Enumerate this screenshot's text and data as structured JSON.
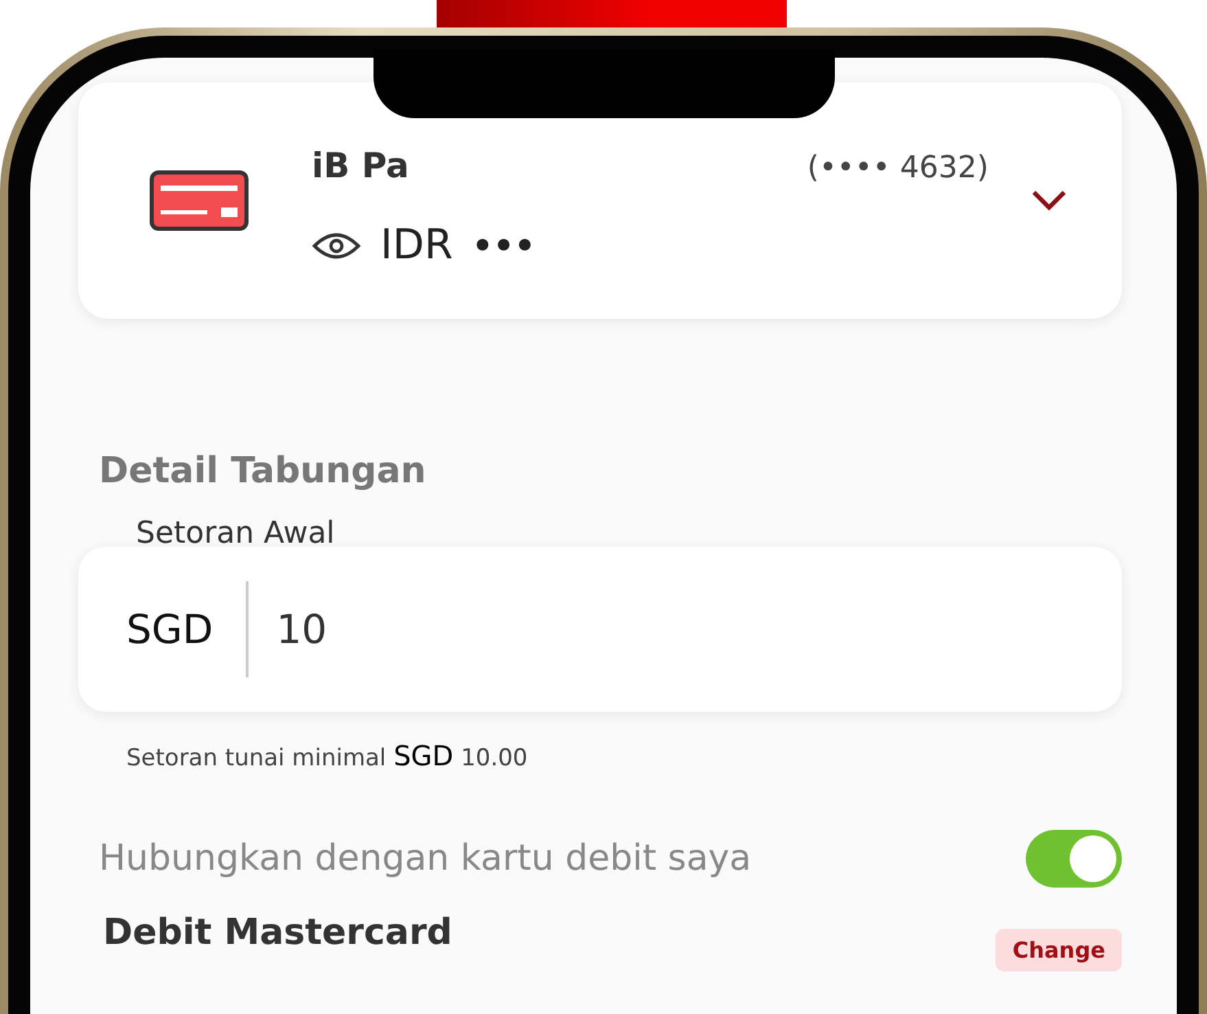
{
  "account": {
    "name": "iB Pa",
    "number": "(•••• 4632)",
    "currency": "IDR",
    "balance": "•••"
  },
  "section_title": "Detail Tabungan",
  "deposit_field": {
    "label": "Setoran Awal",
    "currency": "SGD",
    "value": "10"
  },
  "hint": {
    "text": "Setoran tunai minimal",
    "currency": "SGD",
    "amount": "10.00"
  },
  "link_debit": {
    "label": "Hubungkan dengan kartu debit saya",
    "on": true
  },
  "debit_card": {
    "name": "Debit Mastercard",
    "action": "Change"
  }
}
